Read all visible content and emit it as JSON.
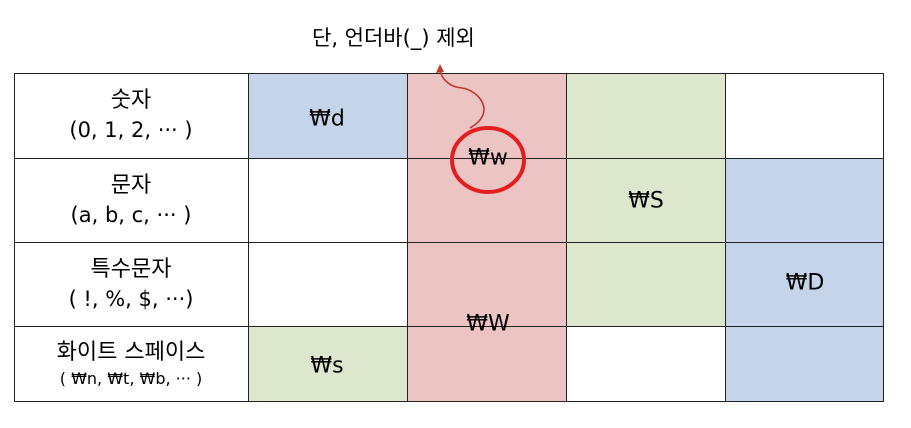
{
  "note": "단, 언더바(_) 제외",
  "rows": [
    {
      "label": "숫자",
      "sub": "(0, 1, 2, ··· )"
    },
    {
      "label": "문자",
      "sub": "(a, b, c, ··· )"
    },
    {
      "label": "특수문자",
      "sub": "( !, %, $, ···)"
    },
    {
      "label": "화이트 스페이스",
      "sub": "( ₩n, ₩t, ₩b, ··· )"
    }
  ],
  "tokens": {
    "d": "₩d",
    "w": "₩w",
    "S": "₩S",
    "D": "₩D",
    "W": "₩W",
    "s": "₩s"
  },
  "colors": {
    "blue": "#c5d4e9",
    "pink": "#edc4c4",
    "green": "#dde7ce",
    "circle": "#e41e1e",
    "arrow": "#c0392b",
    "grid": "#222222"
  }
}
